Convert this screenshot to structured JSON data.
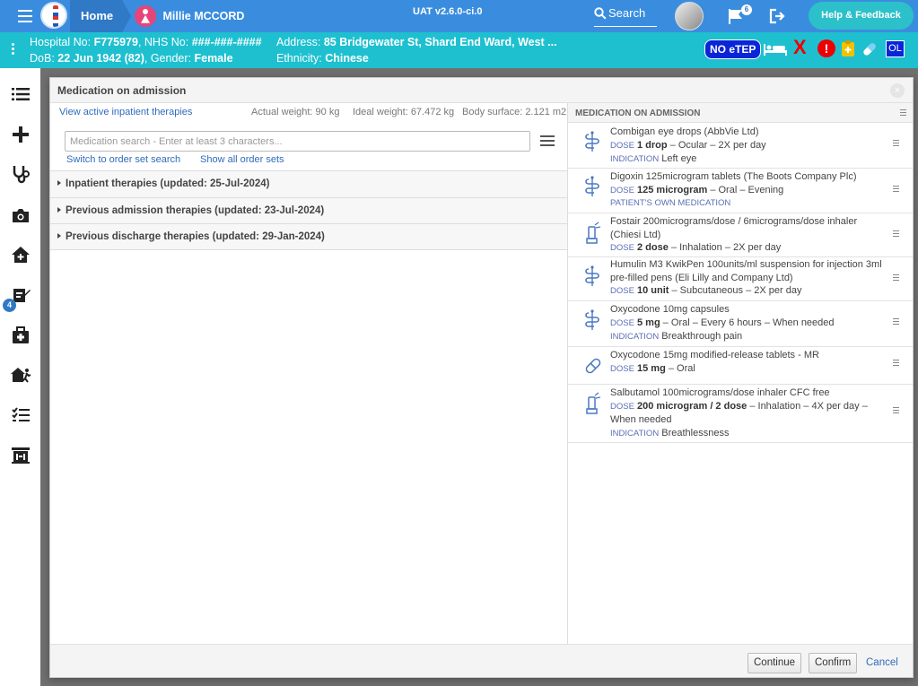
{
  "topbar": {
    "home_label": "Home",
    "patient_name": "Millie MCCORD",
    "version": "UAT v2.6.0-ci.0",
    "search_label": "Search",
    "flag_count": "6",
    "help_label": "Help & Feedback"
  },
  "patient": {
    "hospital_no_label": "Hospital No:",
    "hospital_no": "F775979",
    "nhs_label": "NHS No:",
    "nhs_no": "###-###-####",
    "address_label": "Address:",
    "address": "85 Bridgewater St, Shard End Ward, West ...",
    "dob_label": "DoB:",
    "dob": "22 Jun 1942 (82)",
    "gender_label": "Gender:",
    "gender": "Female",
    "ethnicity_label": "Ethnicity:",
    "ethnicity": "Chinese",
    "no_etep_label": "NO eTEP",
    "ol_label": "OL"
  },
  "sidebar": {
    "items": [
      {
        "icon": "list-icon"
      },
      {
        "icon": "plus-icon"
      },
      {
        "icon": "stethoscope-icon"
      },
      {
        "icon": "camera-icon"
      },
      {
        "icon": "home-plus-icon"
      },
      {
        "icon": "prescription-edit-icon",
        "badge": "4"
      },
      {
        "icon": "medical-bag-icon"
      },
      {
        "icon": "discharge-icon"
      },
      {
        "icon": "checklist-icon"
      },
      {
        "icon": "ward-icon"
      }
    ]
  },
  "modal": {
    "title": "Medication on admission",
    "close_label": "×",
    "left": {
      "view_active_link": "View active inpatient therapies",
      "actual_weight": "Actual weight: 90 kg",
      "ideal_weight": "Ideal weight: 67.472 kg",
      "body_surface": "Body surface: 2.121 m2",
      "search_placeholder": "Medication search - Enter at least 3 characters...",
      "switch_link": "Switch to order set search",
      "show_all_link": "Show all order sets",
      "sections": [
        {
          "label": "Inpatient therapies (updated: 25-Jul-2024)"
        },
        {
          "label": "Previous admission therapies (updated: 23-Jul-2024)"
        },
        {
          "label": "Previous discharge therapies (updated: 29-Jan-2024)"
        }
      ]
    },
    "right": {
      "header": "MEDICATION ON ADMISSION",
      "dose_label": "DOSE",
      "indication_label": "INDICATION",
      "meds": [
        {
          "name": "Combigan eye drops (AbbVie Ltd)",
          "dose": "1 drop",
          "rest": " – Ocular – 2X per day",
          "indication": "Left eye",
          "icon": "snake-staff-icon"
        },
        {
          "name": "Digoxin 125microgram tablets (The Boots Company Plc)",
          "dose": "125 microgram",
          "rest": " – Oral – Evening",
          "own": "PATIENT'S OWN MEDICATION",
          "icon": "snake-staff-icon"
        },
        {
          "name": "Fostair 200micrograms/dose / 6micrograms/dose inhaler (Chiesi Ltd)",
          "dose": "2 dose",
          "rest": " – Inhalation – 2X per day",
          "icon": "inhaler-icon"
        },
        {
          "name": "Humulin M3 KwikPen 100units/ml suspension for injection 3ml pre-filled pens (Eli Lilly and Company Ltd)",
          "dose": "10 unit",
          "rest": " – Subcutaneous – 2X per day",
          "icon": "snake-staff-icon"
        },
        {
          "name": "Oxycodone 10mg capsules",
          "dose": "5 mg",
          "rest": " – Oral – Every 6 hours – When needed",
          "indication": "Breakthrough pain",
          "icon": "snake-staff-icon"
        },
        {
          "name": "Oxycodone 15mg modified-release tablets - MR",
          "dose": "15 mg",
          "rest": " – Oral",
          "icon": "capsule-icon"
        },
        {
          "name": "Salbutamol 100micrograms/dose inhaler CFC free",
          "dose": "200 microgram / 2 dose",
          "rest": " – Inhalation – 4X per day – When needed",
          "indication": "Breathlessness",
          "icon": "inhaler-icon"
        }
      ]
    },
    "footer": {
      "continue_label": "Continue",
      "confirm_label": "Confirm",
      "cancel_label": "Cancel"
    }
  }
}
